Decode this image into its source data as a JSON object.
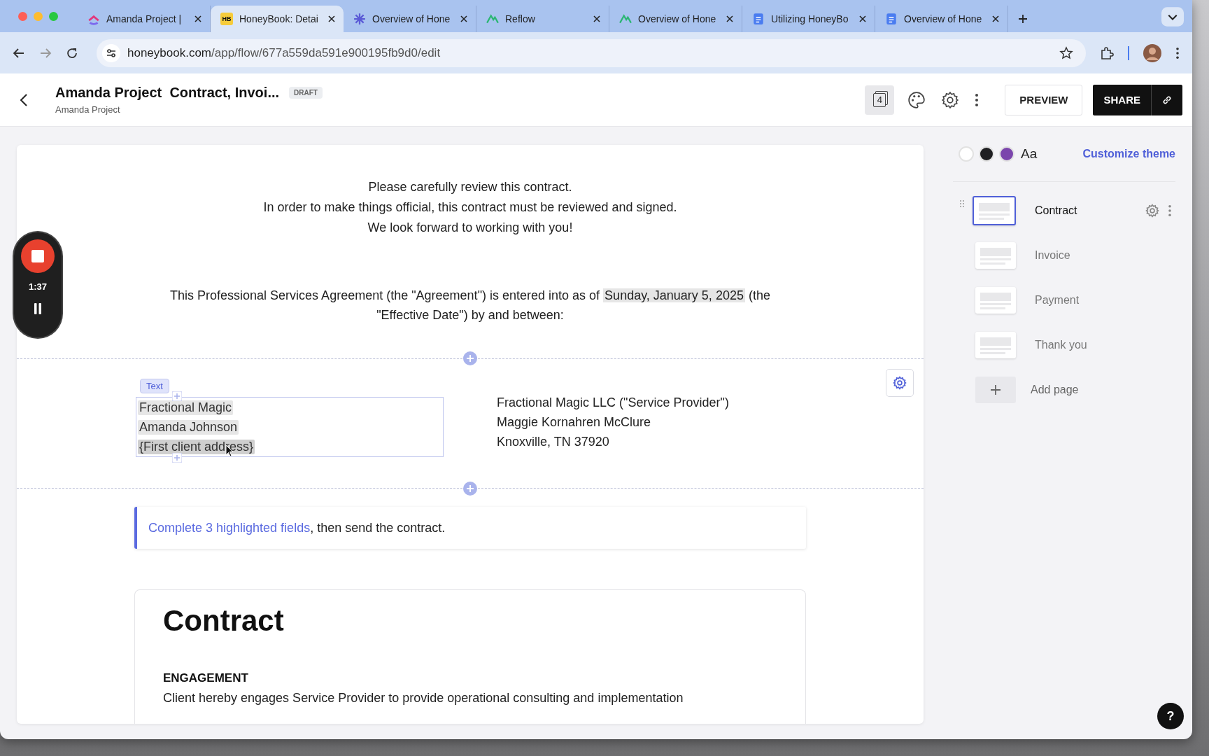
{
  "browser": {
    "tabs": [
      {
        "title": "Amanda Project |",
        "kind": "clickup",
        "selected": false
      },
      {
        "title": "HoneyBook: Detai",
        "kind": "honeybook",
        "logo_text": "HB",
        "selected": true
      },
      {
        "title": "Overview of Hone",
        "kind": "burst",
        "selected": false
      },
      {
        "title": "Reflow",
        "kind": "peaks",
        "selected": false
      },
      {
        "title": "Overview of Hone",
        "kind": "peaks",
        "selected": false
      },
      {
        "title": "Utilizing HoneyBo",
        "kind": "doc",
        "selected": false
      },
      {
        "title": "Overview of Hone",
        "kind": "doc",
        "selected": false
      }
    ],
    "address": {
      "host": "honeybook.com",
      "path": "/app/flow/677a559da591e900195fb9d0/edit"
    }
  },
  "header": {
    "title": "Amanda Project  Contract, Invoi...",
    "subtitle": "Amanda Project",
    "status": "DRAFT",
    "page_count": "4",
    "preview": "PREVIEW",
    "share": "SHARE"
  },
  "recorder": {
    "time": "1:37"
  },
  "document": {
    "intro": [
      "Please carefully review this contract.",
      "In order to make things official, this contract must be reviewed and signed.",
      "We look forward to working with you!"
    ],
    "agreement_start": "This Professional Services Agreement (the \"Agreement\") is entered into as of ",
    "date": "Sunday, January 5, 2025",
    "agreement_end": "  (the \"Effective Date\") by and between:",
    "block_tag": "Text",
    "client_lines": [
      {
        "text": "Fractional Magic",
        "kind": "value"
      },
      {
        "text": "Amanda Johnson",
        "kind": "value"
      },
      {
        "text": "{First client address}",
        "kind": "placeholder"
      }
    ],
    "provider_lines": [
      "Fractional Magic LLC (\"Service Provider\")",
      "Maggie Kornahren McClure",
      "Knoxville, TN 37920"
    ],
    "callout": {
      "link": "Complete 3 highlighted fields",
      "text": ", then send the contract."
    },
    "section": {
      "title": "Contract",
      "heading": "ENGAGEMENT",
      "body": "Client hereby engages Service Provider to provide operational consulting and implementation"
    }
  },
  "theme": {
    "swatches": [
      {
        "color": "#ffffff"
      },
      {
        "color": "#1f1f22"
      },
      {
        "color": "#7b45ac"
      }
    ],
    "font_sample": "Aa",
    "link": "Customize theme"
  },
  "pages": [
    {
      "name": "Contract",
      "selected": true
    },
    {
      "name": "Invoice",
      "selected": false
    },
    {
      "name": "Payment",
      "selected": false
    },
    {
      "name": "Thank you",
      "selected": false
    }
  ],
  "add_page": "Add page",
  "help": "?"
}
